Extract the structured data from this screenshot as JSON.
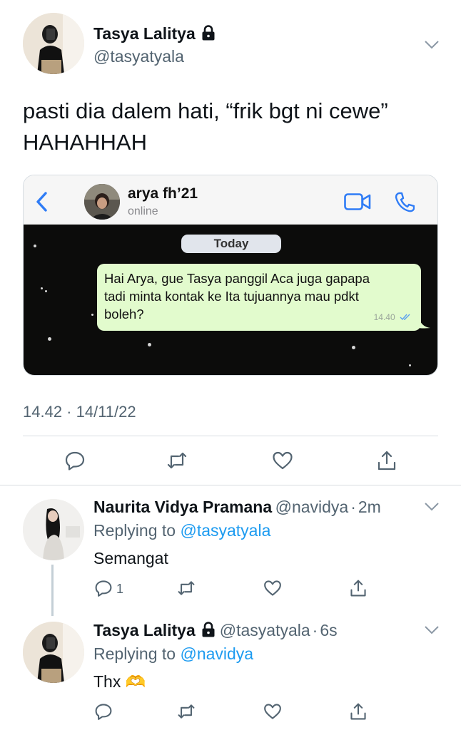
{
  "main_tweet": {
    "author_name": "Tasya Lalitya",
    "author_handle": "@tasyatyala",
    "text_line1": "pasti dia dalem hati, “frik bgt ni cewe”",
    "text_line2": "HAHAHHAH",
    "timestamp": "14.42 · 14/11/22"
  },
  "chat_screenshot": {
    "contact_name": "arya fh’21",
    "contact_status": "online",
    "date_chip": "Today",
    "message_line1": "Hai Arya, gue Tasya panggil Aca juga gapapa",
    "message_line2": "tadi minta kontak ke Ita tujuannya mau pdkt",
    "message_line3": "boleh?",
    "message_time": "14.40"
  },
  "replies": [
    {
      "author_name": "Naurita Vidya Pramana",
      "author_handle": "@navidya",
      "separator": "·",
      "time": "2m",
      "replying_prefix": "Replying to",
      "replying_to": "@tasyatyala",
      "text": "Semangat",
      "reply_count": "1"
    },
    {
      "author_name": "Tasya Lalitya",
      "author_handle": "@tasyatyala",
      "separator": "·",
      "time": "6s",
      "replying_prefix": "Replying to",
      "replying_to": "@navidya",
      "text": "Thx 🫶"
    }
  ],
  "colors": {
    "link": "#1d9bf0",
    "secondary_text": "#536471",
    "whatsapp_bubble": "#e2fbcd",
    "whatsapp_blue": "#2f7cf6"
  },
  "icons": [
    "reply-icon",
    "retweet-icon",
    "like-icon",
    "share-icon",
    "lock-icon",
    "chevron-down-icon",
    "back-icon",
    "video-call-icon",
    "phone-icon",
    "double-check-icon"
  ]
}
